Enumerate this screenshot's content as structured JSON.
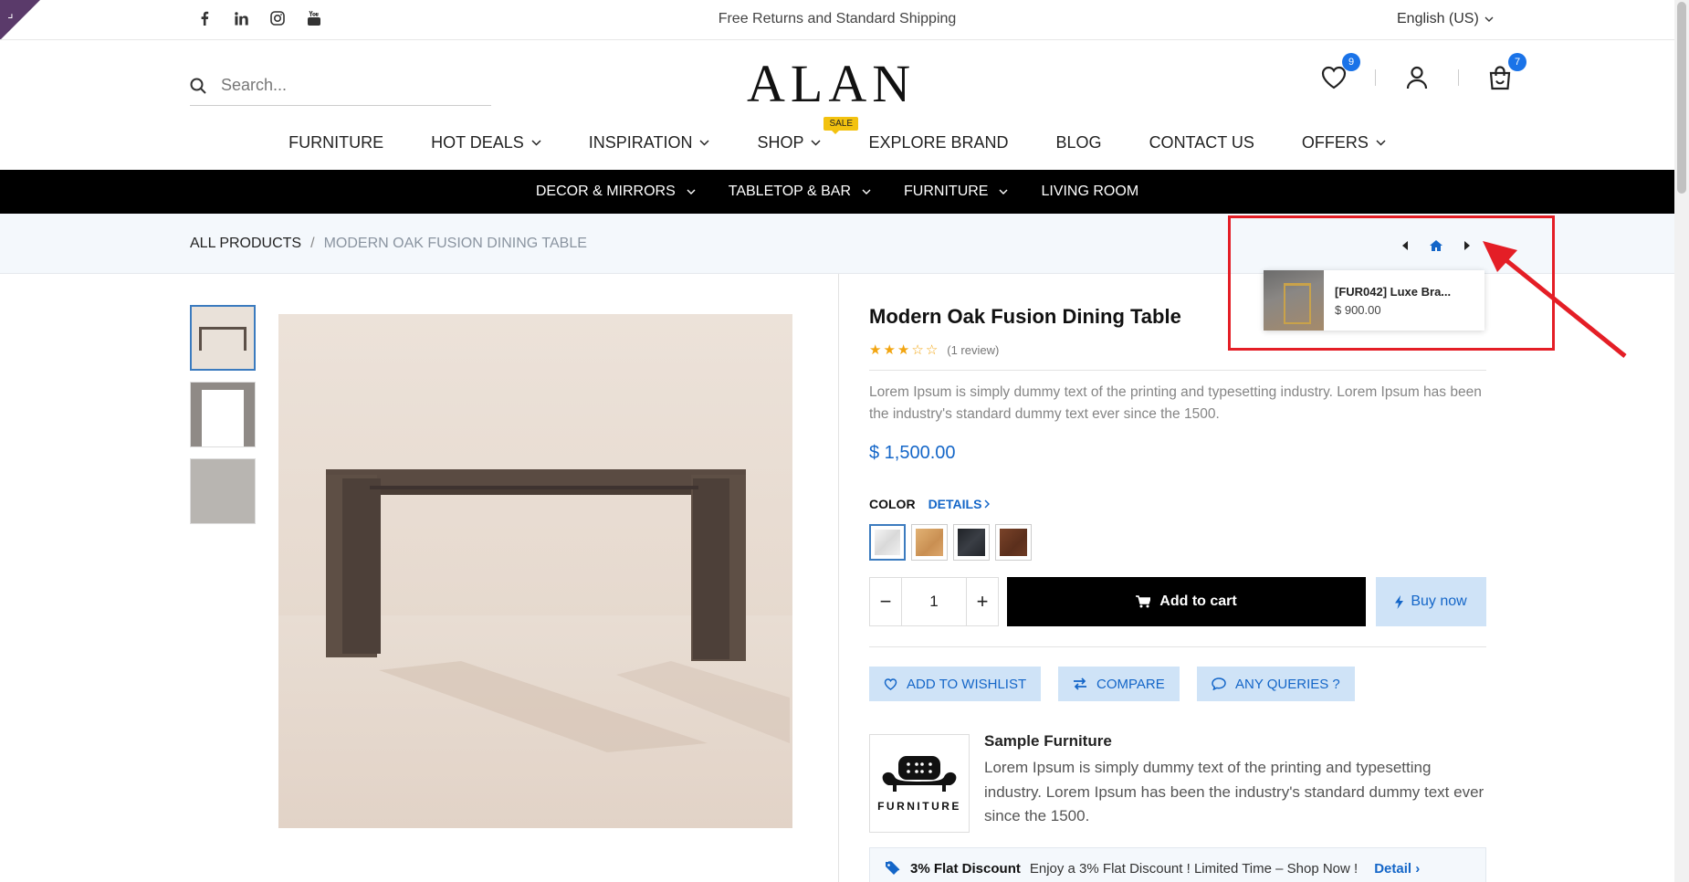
{
  "topbar": {
    "promo": "Free Returns and Standard Shipping",
    "language": "English (US)",
    "social_icons": [
      "facebook-icon",
      "linkedin-icon",
      "instagram-icon",
      "youtube-icon"
    ]
  },
  "header": {
    "search_placeholder": "Search...",
    "logo": "ALAN",
    "wishlist_count": "9",
    "cart_count": "7"
  },
  "main_nav": [
    {
      "label": "FURNITURE",
      "dropdown": false
    },
    {
      "label": "HOT DEALS",
      "dropdown": true
    },
    {
      "label": "INSPIRATION",
      "dropdown": true
    },
    {
      "label": "SHOP",
      "dropdown": true,
      "badge": "SALE"
    },
    {
      "label": "EXPLORE BRAND",
      "dropdown": false
    },
    {
      "label": "BLOG",
      "dropdown": false
    },
    {
      "label": "CONTACT US",
      "dropdown": false
    },
    {
      "label": "OFFERS",
      "dropdown": true
    }
  ],
  "sub_nav": [
    {
      "label": "DECOR & MIRRORS",
      "dropdown": true
    },
    {
      "label": "TABLETOP & BAR",
      "dropdown": true
    },
    {
      "label": "FURNITURE",
      "dropdown": true
    },
    {
      "label": "LIVING ROOM",
      "dropdown": false
    }
  ],
  "breadcrumb": {
    "root": "ALL PRODUCTS",
    "separator": "/",
    "current": "MODERN OAK FUSION DINING TABLE"
  },
  "pager_preview": {
    "title": "[FUR042] Luxe Bra...",
    "price": "$ 900.00"
  },
  "product": {
    "title": "Modern Oak Fusion Dining Table",
    "rating": 3,
    "rating_max": 5,
    "review_count": "(1 review)",
    "description": "Lorem Ipsum is simply dummy text of the printing and typesetting industry. Lorem Ipsum has been the industry's standard dummy text ever since the 1500.",
    "price": "$ 1,500.00",
    "color_label": "COLOR",
    "details_label": "DETAILS",
    "swatches": [
      {
        "name": "white-marble",
        "color": "#e9e9e9"
      },
      {
        "name": "oak",
        "color": "#d9a86a"
      },
      {
        "name": "black-marble",
        "color": "#2a2d33"
      },
      {
        "name": "walnut",
        "color": "#6b3b25"
      }
    ],
    "quantity": "1",
    "add_to_cart": "Add to cart",
    "buy_now": "Buy now",
    "wishlist": "ADD TO WISHLIST",
    "compare": "COMPARE",
    "queries": "ANY QUERIES ?"
  },
  "brand": {
    "logo_text": "FURNITURE",
    "name": "Sample Furniture",
    "description": "Lorem Ipsum is simply dummy text of the printing and typesetting industry. Lorem Ipsum has been the industry's standard dummy text ever since the 1500."
  },
  "offer": {
    "title": "3% Flat Discount",
    "text": "Enjoy a 3% Flat Discount ! Limited Time – Shop Now !",
    "link": "Detail"
  },
  "colors": {
    "accent": "#1466c8",
    "badge": "#1a73e8",
    "sale": "#f3c20f",
    "highlight": "#e41e26"
  }
}
